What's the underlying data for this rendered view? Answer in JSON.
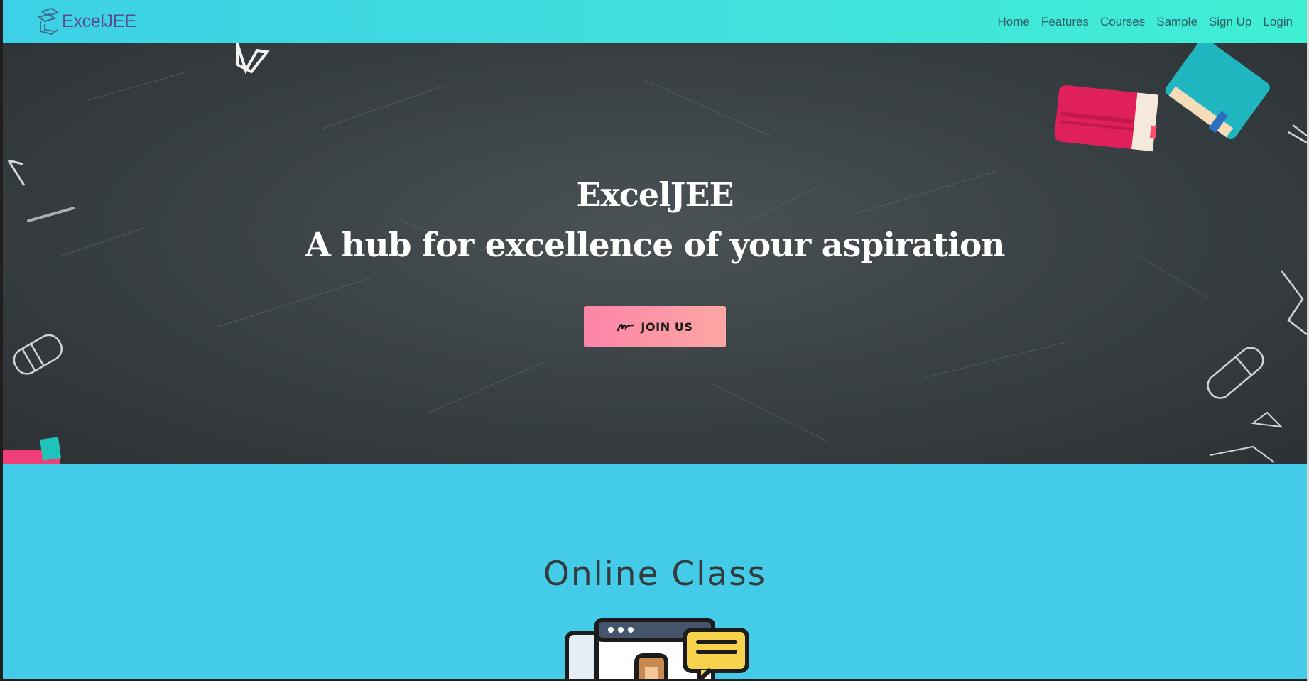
{
  "brand": {
    "name": "ExcelJEE"
  },
  "nav": {
    "items": [
      {
        "label": "Home"
      },
      {
        "label": "Features"
      },
      {
        "label": "Courses"
      },
      {
        "label": "Sample"
      },
      {
        "label": "Sign Up"
      },
      {
        "label": "Login"
      }
    ]
  },
  "hero": {
    "title": "ExcelJEE",
    "subtitle": "A hub for excellence of your aspiration",
    "cta_label": "JOIN US"
  },
  "online_class": {
    "title": "Online Class"
  },
  "colors": {
    "navbar": "#41dcdf",
    "hero_bg": "#3b4245",
    "section_bg": "#43cbe8",
    "cta": "#fd84a8"
  }
}
